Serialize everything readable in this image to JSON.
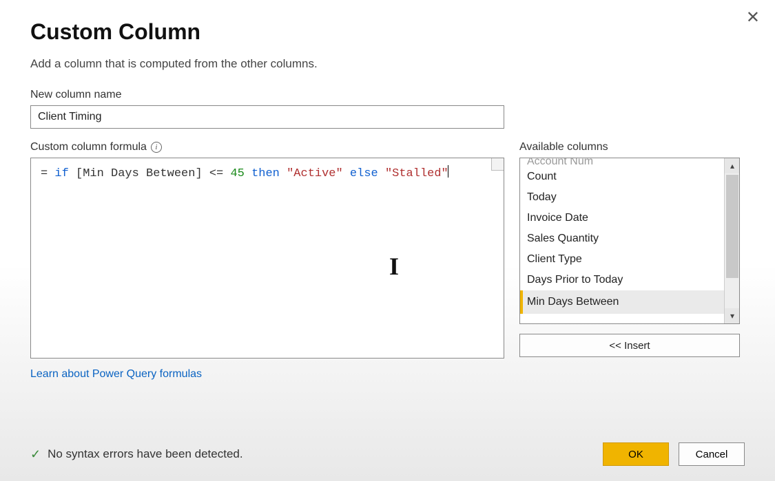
{
  "header": {
    "title": "Custom Column",
    "subtitle": "Add a column that is computed from the other columns."
  },
  "name_field": {
    "label": "New column name",
    "value": "Client Timing"
  },
  "formula": {
    "label": "Custom column formula",
    "prefix": "=",
    "tokens": {
      "if": "if",
      "col": "[Min Days Between]",
      "op": "<=",
      "num": "45",
      "then": "then",
      "str1": "\"Active\"",
      "else": "else",
      "str2": "\"Stalled\""
    },
    "raw": "= if [Min Days Between] <= 45 then \"Active\" else \"Stalled\""
  },
  "available": {
    "label": "Available columns",
    "partial_top": "Account Num",
    "items": [
      "Count",
      "Today",
      "Invoice Date",
      "Sales Quantity",
      "Client Type",
      "Days Prior to Today",
      "Min Days Between"
    ],
    "selected_index": 6,
    "insert_label": "<< Insert"
  },
  "link": "Learn about Power Query formulas",
  "status": "No syntax errors have been detected.",
  "buttons": {
    "ok": "OK",
    "cancel": "Cancel"
  }
}
